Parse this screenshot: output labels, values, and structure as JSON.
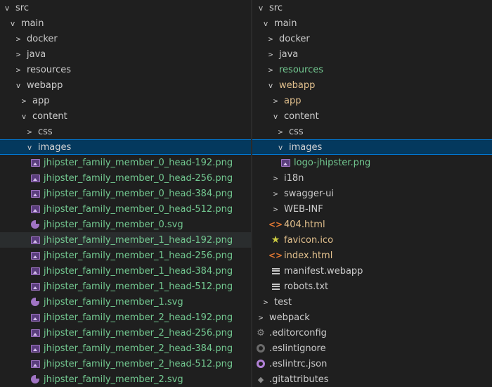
{
  "left_tree": {
    "rows": [
      {
        "label": "src",
        "kind": "folder-open",
        "indent": 0
      },
      {
        "label": "main",
        "kind": "folder-open",
        "indent": 1
      },
      {
        "label": "docker",
        "kind": "folder-closed",
        "indent": 2
      },
      {
        "label": "java",
        "kind": "folder-closed",
        "indent": 2
      },
      {
        "label": "resources",
        "kind": "folder-closed",
        "indent": 2
      },
      {
        "label": "webapp",
        "kind": "folder-open",
        "indent": 2
      },
      {
        "label": "app",
        "kind": "folder-closed",
        "indent": 3
      },
      {
        "label": "content",
        "kind": "folder-open",
        "indent": 3
      },
      {
        "label": "css",
        "kind": "folder-closed",
        "indent": 4
      },
      {
        "label": "images",
        "kind": "folder-open",
        "indent": 4,
        "selected": true
      },
      {
        "label": "jhipster_family_member_0_head-192.png",
        "kind": "image",
        "indent": 5
      },
      {
        "label": "jhipster_family_member_0_head-256.png",
        "kind": "image",
        "indent": 5
      },
      {
        "label": "jhipster_family_member_0_head-384.png",
        "kind": "image",
        "indent": 5
      },
      {
        "label": "jhipster_family_member_0_head-512.png",
        "kind": "image",
        "indent": 5
      },
      {
        "label": "jhipster_family_member_0.svg",
        "kind": "svg",
        "indent": 5
      },
      {
        "label": "jhipster_family_member_1_head-192.png",
        "kind": "image",
        "indent": 5,
        "hovered": true
      },
      {
        "label": "jhipster_family_member_1_head-256.png",
        "kind": "image",
        "indent": 5
      },
      {
        "label": "jhipster_family_member_1_head-384.png",
        "kind": "image",
        "indent": 5
      },
      {
        "label": "jhipster_family_member_1_head-512.png",
        "kind": "image",
        "indent": 5
      },
      {
        "label": "jhipster_family_member_1.svg",
        "kind": "svg",
        "indent": 5
      },
      {
        "label": "jhipster_family_member_2_head-192.png",
        "kind": "image",
        "indent": 5
      },
      {
        "label": "jhipster_family_member_2_head-256.png",
        "kind": "image",
        "indent": 5
      },
      {
        "label": "jhipster_family_member_2_head-384.png",
        "kind": "image",
        "indent": 5
      },
      {
        "label": "jhipster_family_member_2_head-512.png",
        "kind": "image",
        "indent": 5
      },
      {
        "label": "jhipster_family_member_2.svg",
        "kind": "svg",
        "indent": 5
      }
    ]
  },
  "right_tree": {
    "rows": [
      {
        "label": "src",
        "kind": "folder-open",
        "indent": 0
      },
      {
        "label": "main",
        "kind": "folder-open",
        "indent": 1
      },
      {
        "label": "docker",
        "kind": "folder-closed",
        "indent": 2
      },
      {
        "label": "java",
        "kind": "folder-closed",
        "indent": 2
      },
      {
        "label": "resources",
        "kind": "folder-closed",
        "indent": 2,
        "color": "green"
      },
      {
        "label": "webapp",
        "kind": "folder-open",
        "indent": 2,
        "color": "yellow"
      },
      {
        "label": "app",
        "kind": "folder-closed",
        "indent": 3,
        "color": "yellow"
      },
      {
        "label": "content",
        "kind": "folder-open",
        "indent": 3
      },
      {
        "label": "css",
        "kind": "folder-closed",
        "indent": 4
      },
      {
        "label": "images",
        "kind": "folder-open",
        "indent": 4,
        "selected": true
      },
      {
        "label": "logo-jhipster.png",
        "kind": "image",
        "indent": 5
      },
      {
        "label": "i18n",
        "kind": "folder-closed",
        "indent": 3
      },
      {
        "label": "swagger-ui",
        "kind": "folder-closed",
        "indent": 3
      },
      {
        "label": "WEB-INF",
        "kind": "folder-closed",
        "indent": 3
      },
      {
        "label": "404.html",
        "kind": "html",
        "indent": 3,
        "color": "yellow"
      },
      {
        "label": "favicon.ico",
        "kind": "star",
        "indent": 3,
        "color": "yellow"
      },
      {
        "label": "index.html",
        "kind": "html",
        "indent": 3,
        "color": "yellow"
      },
      {
        "label": "manifest.webapp",
        "kind": "lines",
        "indent": 3
      },
      {
        "label": "robots.txt",
        "kind": "lines",
        "indent": 3
      },
      {
        "label": "test",
        "kind": "folder-closed",
        "indent": 1
      },
      {
        "label": "webpack",
        "kind": "folder-closed",
        "indent": 0
      },
      {
        "label": ".editorconfig",
        "kind": "gear",
        "indent": 0
      },
      {
        "label": ".eslintignore",
        "kind": "ring-grey",
        "indent": 0
      },
      {
        "label": ".eslintrc.json",
        "kind": "ring",
        "indent": 0
      },
      {
        "label": ".gitattributes",
        "kind": "diamond",
        "indent": 0
      }
    ]
  },
  "colors": {
    "background": "#1f1f1f",
    "selection": "#04395e",
    "selection_border": "#0078d4",
    "hover": "#2a2d2e",
    "green_text": "#73c991",
    "yellow_text": "#e2c08d",
    "default_text": "#cccccc"
  }
}
